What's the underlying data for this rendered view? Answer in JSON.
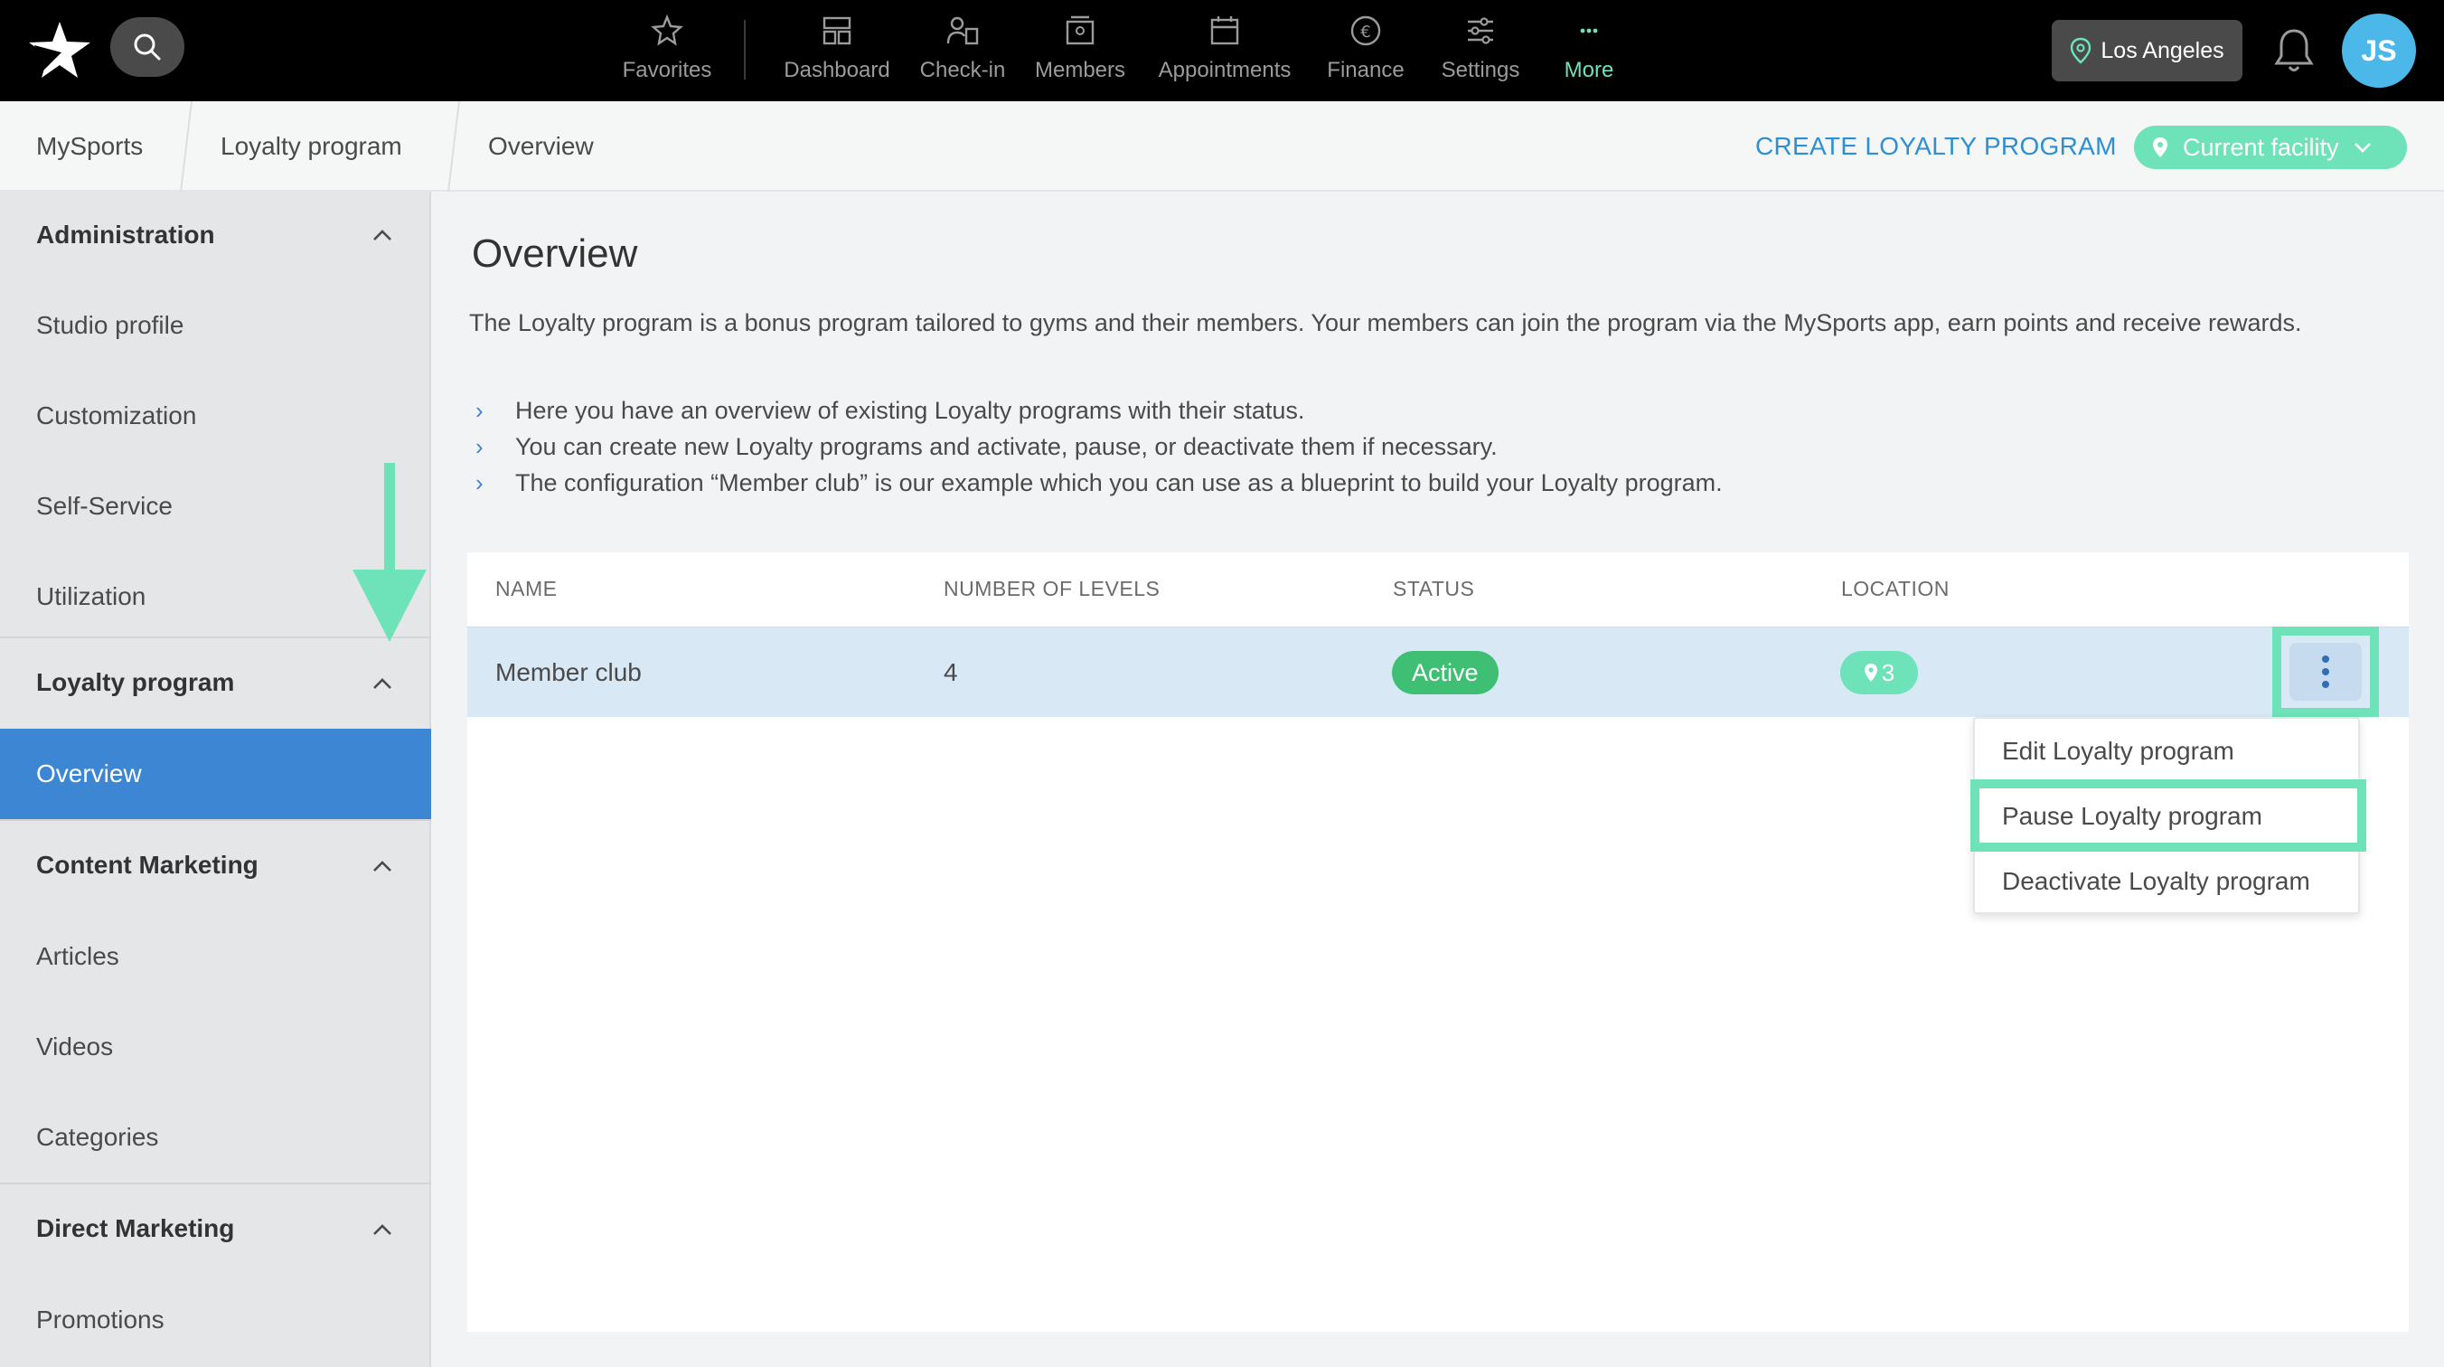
{
  "topbar": {
    "nav": [
      {
        "label": "Favorites",
        "icon": "star-icon"
      },
      {
        "label": "Dashboard",
        "icon": "dashboard-icon"
      },
      {
        "label": "Check-in",
        "icon": "checkin-icon"
      },
      {
        "label": "Members",
        "icon": "members-icon"
      },
      {
        "label": "Appointments",
        "icon": "calendar-icon"
      },
      {
        "label": "Finance",
        "icon": "euro-icon"
      },
      {
        "label": "Settings",
        "icon": "sliders-icon"
      },
      {
        "label": "More",
        "icon": "more-dots-icon"
      }
    ],
    "location": "Los Angeles",
    "avatar_initials": "JS",
    "accent": "#6ee2b9"
  },
  "breadcrumb": {
    "items": [
      "MySports",
      "Loyalty program",
      "Overview"
    ],
    "create_link": "CREATE LOYALTY PROGRAM",
    "facility": "Current facility"
  },
  "sidebar": {
    "items": [
      {
        "label": "Administration",
        "type": "header"
      },
      {
        "label": "Studio profile",
        "type": "item"
      },
      {
        "label": "Customization",
        "type": "item"
      },
      {
        "label": "Self-Service",
        "type": "item"
      },
      {
        "label": "Utilization",
        "type": "item"
      },
      {
        "label": "Loyalty program",
        "type": "header"
      },
      {
        "label": "Overview",
        "type": "item",
        "active": true
      },
      {
        "label": "Content Marketing",
        "type": "header"
      },
      {
        "label": "Articles",
        "type": "item"
      },
      {
        "label": "Videos",
        "type": "item"
      },
      {
        "label": "Categories",
        "type": "item"
      },
      {
        "label": "Direct Marketing",
        "type": "header"
      },
      {
        "label": "Promotions",
        "type": "item"
      }
    ]
  },
  "main": {
    "title": "Overview",
    "intro": "The Loyalty program is a bonus program tailored to gyms and their members. Your members can join the program via the MySports app, earn points and receive rewards.",
    "bullets": [
      "Here you have an overview of existing Loyalty programs with their status.",
      "You can create new Loyalty programs and activate, pause, or deactivate them if necessary.",
      "The configuration “Member club” is our example which you can use as a blueprint to build your Loyalty program."
    ],
    "table": {
      "headers": [
        "NAME",
        "NUMBER OF LEVELS",
        "STATUS",
        "LOCATION"
      ],
      "rows": [
        {
          "name": "Member club",
          "levels": "4",
          "status": "Active",
          "locations": "3"
        }
      ]
    },
    "menu": {
      "items": [
        "Edit Loyalty program",
        "Pause Loyalty program",
        "Deactivate Loyalty program"
      ]
    }
  }
}
